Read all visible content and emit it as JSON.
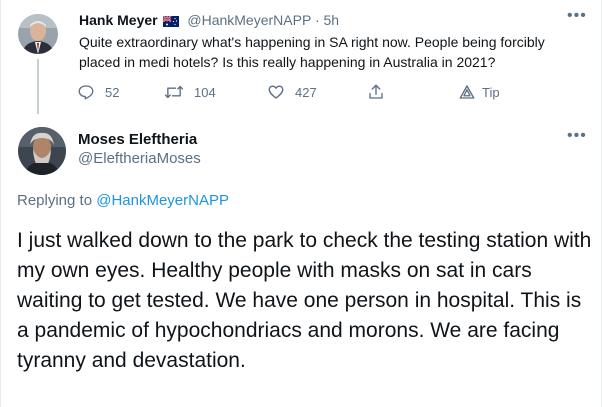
{
  "parent_tweet": {
    "author_name": "Hank Meyer",
    "author_handle": "@HankMeyerNAPP",
    "separator": "·",
    "time": "5h",
    "text": "Quite extraordinary what's happening in SA right now. People being forcibly placed in medi hotels? Is this really happening in Australia in 2021?",
    "more_label": "•••",
    "actions": {
      "reply_count": "52",
      "retweet_count": "104",
      "like_count": "427",
      "tip_label": "Tip"
    },
    "icons": [
      "australian-flag-icon",
      "reply-icon",
      "retweet-icon",
      "like-icon",
      "share-icon",
      "tip-icon",
      "more-icon"
    ]
  },
  "reply_tweet": {
    "author_name": "Moses Eleftheria",
    "author_handle": "@EleftheriaMoses",
    "more_label": "•••",
    "replying_to_prefix": "Replying to ",
    "replying_to_handle": "@HankMeyerNAPP",
    "text": "I just walked down to the park to check the testing station with my own eyes. Healthy people with masks on sat in cars waiting to get tested. We have one person in hospital.  This is a pandemic of hypochondriacs and morons. We are facing tyranny and devastation."
  },
  "colors": {
    "text_primary": "#0f1419",
    "text_secondary": "#5b7083",
    "link": "#1b95e0",
    "thread_line": "#c4cfd6"
  }
}
